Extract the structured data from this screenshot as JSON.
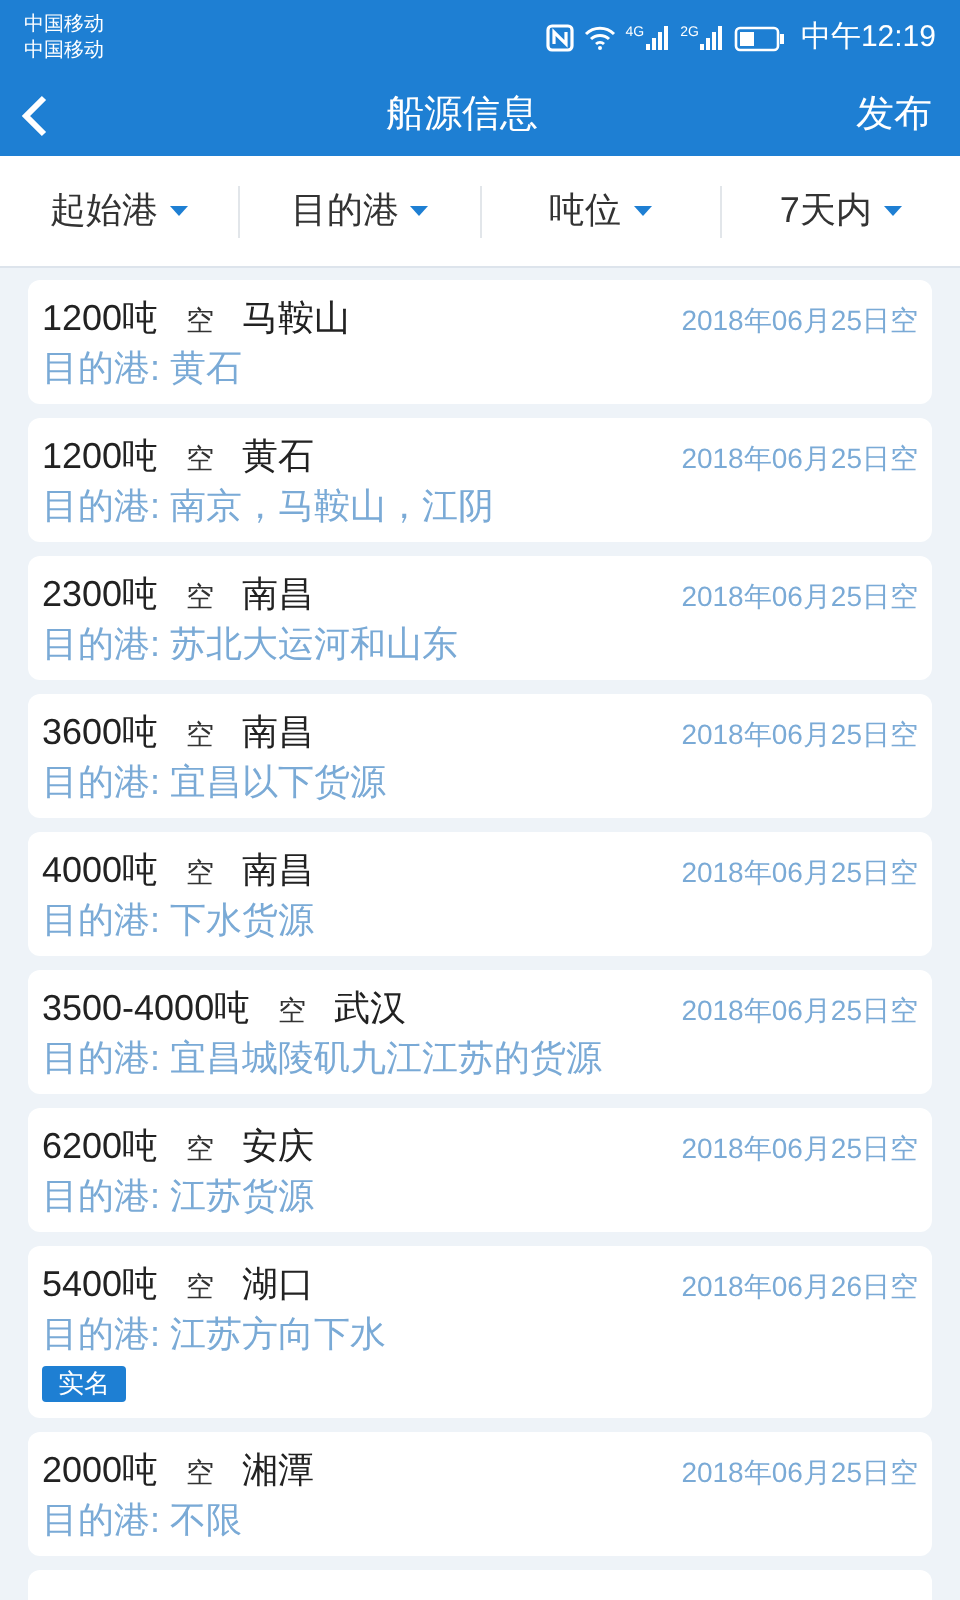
{
  "status_bar": {
    "carriers": [
      "中国移动",
      "中国移动"
    ],
    "network_1": "4G",
    "network_2": "2G",
    "time": "中午12:19"
  },
  "header": {
    "title": "船源信息",
    "action": "发布"
  },
  "filters": [
    {
      "label": "起始港"
    },
    {
      "label": "目的港"
    },
    {
      "label": "吨位"
    },
    {
      "label": "7天内"
    }
  ],
  "listings": [
    {
      "tonnage": "1200吨",
      "state": "空",
      "port": "马鞍山",
      "date": "2018年06月25日空",
      "destination": "目的港: 黄石"
    },
    {
      "tonnage": "1200吨",
      "state": "空",
      "port": "黄石",
      "date": "2018年06月25日空",
      "destination": "目的港: 南京，马鞍山，江阴"
    },
    {
      "tonnage": "2300吨",
      "state": "空",
      "port": "南昌",
      "date": "2018年06月25日空",
      "destination": "目的港: 苏北大运河和山东"
    },
    {
      "tonnage": "3600吨",
      "state": "空",
      "port": "南昌",
      "date": "2018年06月25日空",
      "destination": "目的港: 宜昌以下货源"
    },
    {
      "tonnage": "4000吨",
      "state": "空",
      "port": "南昌",
      "date": "2018年06月25日空",
      "destination": "目的港: 下水货源"
    },
    {
      "tonnage": "3500-4000吨",
      "state": "空",
      "port": "武汉",
      "date": "2018年06月25日空",
      "destination": "目的港: 宜昌城陵矶九江江苏的货源"
    },
    {
      "tonnage": "6200吨",
      "state": "空",
      "port": "安庆",
      "date": "2018年06月25日空",
      "destination": "目的港: 江苏货源"
    },
    {
      "tonnage": "5400吨",
      "state": "空",
      "port": "湖口",
      "date": "2018年06月26日空",
      "destination": "目的港: 江苏方向下水",
      "badge": "实名"
    },
    {
      "tonnage": "2000吨",
      "state": "空",
      "port": "湘潭",
      "date": "2018年06月25日空",
      "destination": "目的港: 不限"
    }
  ]
}
